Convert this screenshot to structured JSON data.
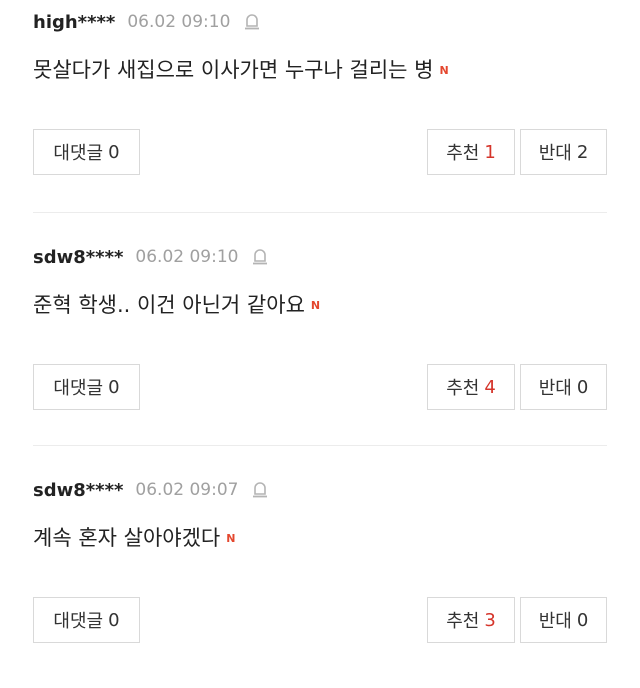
{
  "comments": [
    {
      "user": "high****",
      "date": "06.02 09:10",
      "text": "못살다가 새집으로 이사가면 누구나 걸리는 병",
      "new_badge": "N",
      "reply_label": "대댓글",
      "reply_count": "0",
      "up_label": "추천",
      "up_count": "1",
      "down_label": "반대",
      "down_count": "2"
    },
    {
      "user": "sdw8****",
      "date": "06.02 09:10",
      "text": "준혁 학생.. 이건 아닌거 같아요",
      "new_badge": "N",
      "reply_label": "대댓글",
      "reply_count": "0",
      "up_label": "추천",
      "up_count": "4",
      "down_label": "반대",
      "down_count": "0"
    },
    {
      "user": "sdw8****",
      "date": "06.02 09:07",
      "text": "계속 혼자 살아야겠다",
      "new_badge": "N",
      "reply_label": "대댓글",
      "reply_count": "0",
      "up_label": "추천",
      "up_count": "3",
      "down_label": "반대",
      "down_count": "0"
    }
  ],
  "icons": {
    "report": "siren-report-icon"
  },
  "colors": {
    "new_badge": "#e4472e",
    "up_count": "#d5342a",
    "date_text": "#a0a0a0",
    "button_border": "#d9d9d9"
  }
}
